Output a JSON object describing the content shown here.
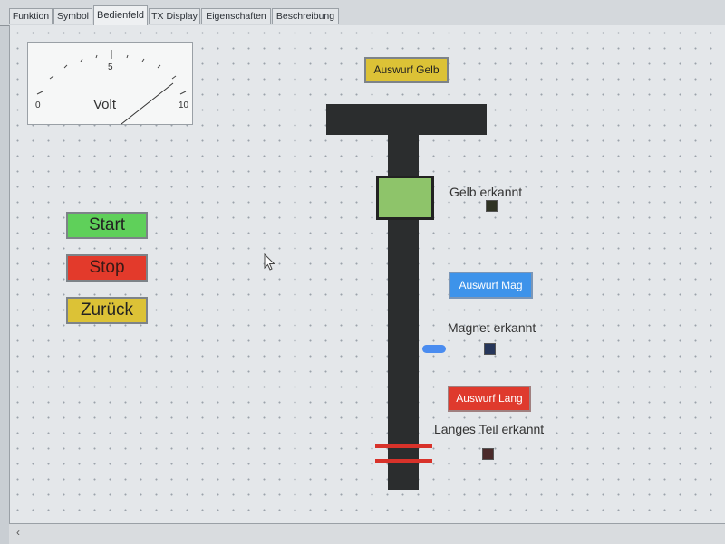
{
  "tabs": [
    {
      "label": "Funktion"
    },
    {
      "label": "Symbol"
    },
    {
      "label": "Bedienfeld"
    },
    {
      "label": "TX Display"
    },
    {
      "label": "Eigenschaften"
    },
    {
      "label": "Beschreibung"
    }
  ],
  "active_tab": "Bedienfeld",
  "gauge": {
    "min_label": "0",
    "mid_label": "5",
    "max_label": "10",
    "unit": "Volt",
    "value": 10
  },
  "buttons": {
    "start": "Start",
    "stop": "Stop",
    "zurueck": "Zurück",
    "auswurf_gelb": "Auswurf Gelb",
    "auswurf_mag": "Auswurf Mag",
    "auswurf_lang": "Auswurf Lang"
  },
  "labels": {
    "gelb_erkannt": "Gelb erkannt",
    "magnet_erkannt": "Magnet erkannt",
    "langes_teil_erkannt": "Langes Teil erkannt"
  },
  "colors": {
    "start": "#5fd05a",
    "stop": "#e33a2b",
    "zurueck": "#dcc236",
    "auswurf_gelb": "#dcc236",
    "auswurf_mag": "#3d93ea",
    "auswurf_lang": "#df3a2d",
    "belt": "#2b2d2e",
    "yellow_part": "#8ec46a",
    "ind_gelb": "#2f3324",
    "ind_magnet": "#26365a",
    "ind_lang": "#4a2a2a"
  },
  "statusbar": {
    "scroll_left_icon": "chevron-left-icon"
  }
}
